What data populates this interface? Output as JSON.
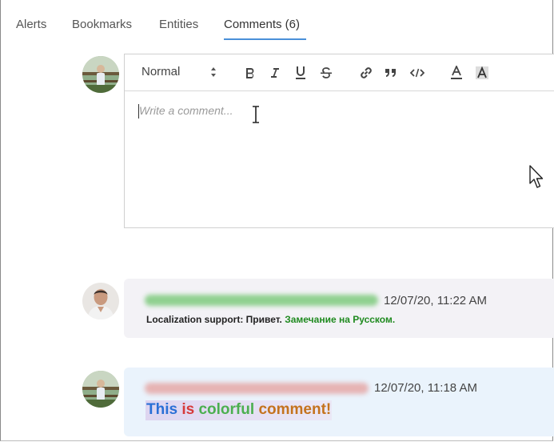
{
  "tabs": [
    {
      "label": "Alerts",
      "active": false
    },
    {
      "label": "Bookmarks",
      "active": false
    },
    {
      "label": "Entities",
      "active": false
    },
    {
      "label": "Comments (6)",
      "active": true
    }
  ],
  "editor": {
    "format_select": "Normal",
    "toolbar": [
      "bold-icon",
      "italic-icon",
      "underline-icon",
      "strikethrough-icon",
      "link-icon",
      "quote-icon",
      "code-icon",
      "font-color-icon",
      "highlight-color-icon"
    ],
    "placeholder": "Write a comment..."
  },
  "comments": [
    {
      "timestamp": "12/07/20, 11:22 AM",
      "body_prefix": "Localization support: Привет.",
      "body_suffix": "Замечание на Русском.",
      "suffix_color": "#1f8a1f",
      "author_blur_color": "#8fd08f"
    },
    {
      "timestamp": "12/07/20, 11:18 AM",
      "words": [
        {
          "text": "This",
          "color": "#2a6fd6"
        },
        {
          "text": "is",
          "color": "#d63a3a"
        },
        {
          "text": "colorful",
          "color": "#4caf50"
        },
        {
          "text": "comment!",
          "color": "#c4731e"
        }
      ],
      "author_blur_color": "#e6b3b3"
    }
  ],
  "colors": {
    "accent": "#4a90d9",
    "comment1_bg": "#f3f2f6",
    "comment2_bg": "#eaf3fc"
  }
}
